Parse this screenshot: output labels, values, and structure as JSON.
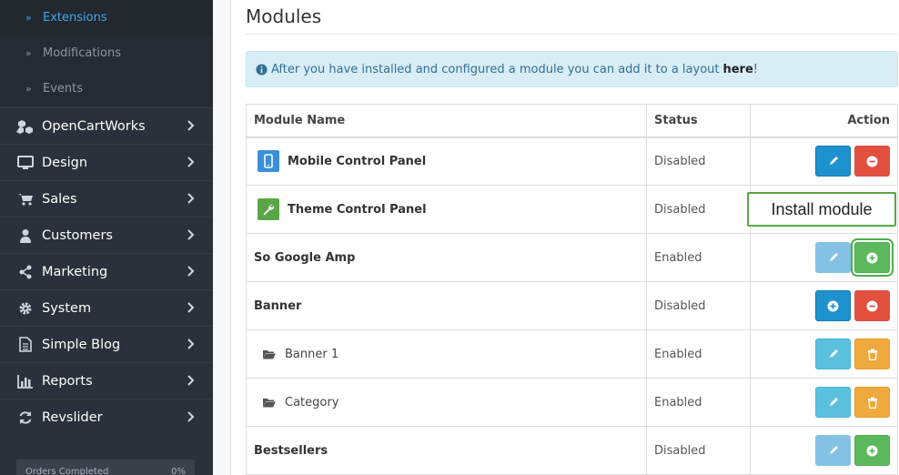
{
  "sidebar": {
    "subitems": [
      {
        "label": "Extensions",
        "active": true
      },
      {
        "label": "Modifications",
        "active": false
      },
      {
        "label": "Events",
        "active": false
      }
    ],
    "items": [
      {
        "label": "OpenCartWorks",
        "icon": "cubes-icon"
      },
      {
        "label": "Design",
        "icon": "monitor-icon"
      },
      {
        "label": "Sales",
        "icon": "cart-icon"
      },
      {
        "label": "Customers",
        "icon": "user-icon"
      },
      {
        "label": "Marketing",
        "icon": "share-icon"
      },
      {
        "label": "System",
        "icon": "gear-icon"
      },
      {
        "label": "Simple Blog",
        "icon": "document-icon"
      },
      {
        "label": "Reports",
        "icon": "bar-chart-icon"
      },
      {
        "label": "Revslider",
        "icon": "refresh-icon"
      }
    ],
    "progress": {
      "label": "Orders Completed",
      "value": "0%"
    }
  },
  "main": {
    "title": "Modules",
    "alert": {
      "text": "After you have installed and configured a module you can add it to a layout",
      "link": "here",
      "suffix": "!"
    },
    "table": {
      "headers": {
        "name": "Module Name",
        "status": "Status",
        "action": "Action"
      },
      "rows": [
        {
          "name": "Mobile Control Panel",
          "status": "Disabled"
        },
        {
          "name": "Theme Control Panel",
          "status": "Disabled"
        },
        {
          "name": "So Google Amp",
          "status": "Enabled"
        },
        {
          "name": "Banner",
          "status": "Disabled"
        },
        {
          "name": "Banner 1",
          "status": "Enabled"
        },
        {
          "name": "Category",
          "status": "Enabled"
        },
        {
          "name": "Bestsellers",
          "status": "Disabled"
        }
      ]
    },
    "callout": "Install module"
  },
  "colors": {
    "sidebar_bg": "#2b313a",
    "active_link": "#3ea6e8",
    "primary": "#1e91cf",
    "danger": "#e3503e",
    "success": "#5cb85c",
    "info": "#5bc0de",
    "warning": "#f0a93c",
    "alert_bg": "#d9edf7"
  }
}
